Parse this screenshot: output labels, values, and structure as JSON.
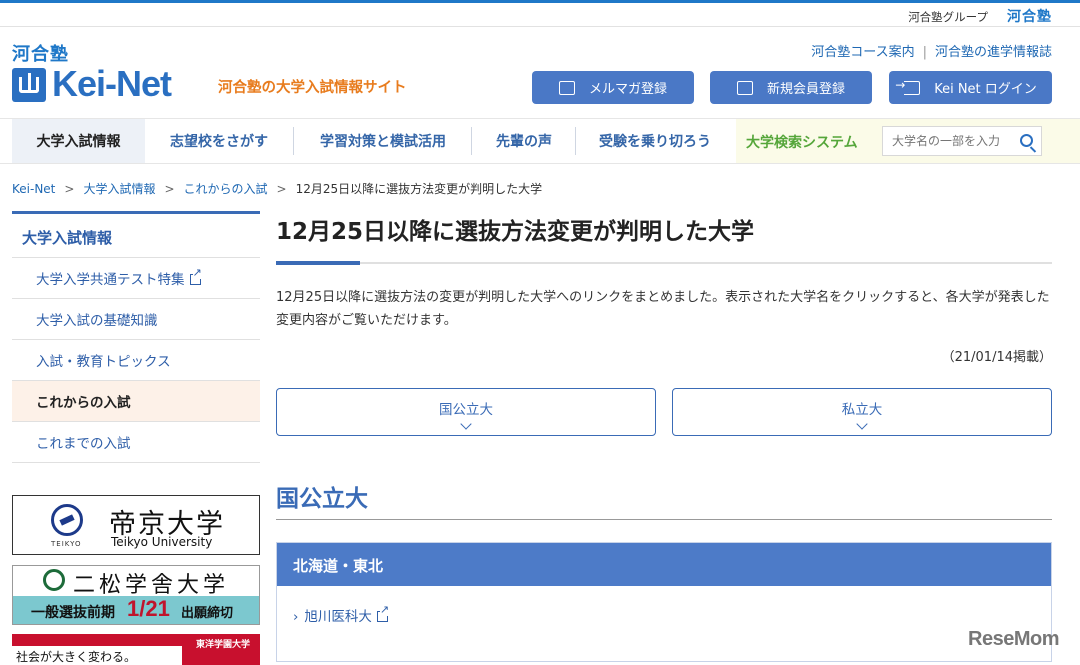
{
  "top": {
    "group_text": "河合塾グループ",
    "group_logo": "河合塾"
  },
  "header": {
    "logo_kawai": "河合塾",
    "logo_keinet": "Kei-Net",
    "tagline": "河合塾の大学入試情報サイト",
    "links": [
      "河合塾コース案内",
      "河合塾の進学情報誌"
    ],
    "buttons": {
      "mail": "メルマガ登録",
      "member": "新規会員登録",
      "login": "Kei Net ログイン"
    }
  },
  "nav": {
    "items": [
      "大学入試情報",
      "志望校をさがす",
      "学習対策と模試活用",
      "先輩の声",
      "受験を乗り切ろう"
    ],
    "search_title": "大学検索システム",
    "search_placeholder": "大学名の一部を入力"
  },
  "breadcrumb": {
    "items": [
      "Kei-Net",
      "大学入試情報",
      "これからの入試"
    ],
    "current": "12月25日以降に選抜方法変更が判明した大学"
  },
  "sidebar": {
    "title": "大学入試情報",
    "items": [
      "大学入学共通テスト特集",
      "大学入試の基礎知識",
      "入試・教育トピックス",
      "これからの入試",
      "これまでの入試"
    ],
    "active_index": 3
  },
  "banners": {
    "teikyo_jp": "帝京大学",
    "teikyo_en": "Teikyo University",
    "teikyo_sub": "TEIKYO",
    "nisho_name": "二松学舎大学",
    "nisho_t1": "一般選抜前期",
    "nisho_t2": "1/21",
    "nisho_t3": "出願締切",
    "toyo_copy": "社会が大きく変わる。",
    "toyo_name": "東洋学園大学"
  },
  "main": {
    "title": "12月25日以降に選抜方法変更が判明した大学",
    "lead": "12月25日以降に選抜方法の変更が判明した大学へのリンクをまとめました。表示された大学名をクリックすると、各大学が発表した変更内容がご覧いただけます。",
    "posted": "（21/01/14掲載）",
    "tabs": [
      "国公立大",
      "私立大"
    ],
    "section_title": "国公立大",
    "region": "北海道・東北",
    "universities": [
      "旭川医科大"
    ]
  },
  "watermark": "ReseMom",
  "colors": {
    "brand_blue": "#2a6fc1",
    "button_blue": "#4a78c6",
    "tagline_orange": "#e87c1e",
    "search_green": "#55a63a"
  }
}
